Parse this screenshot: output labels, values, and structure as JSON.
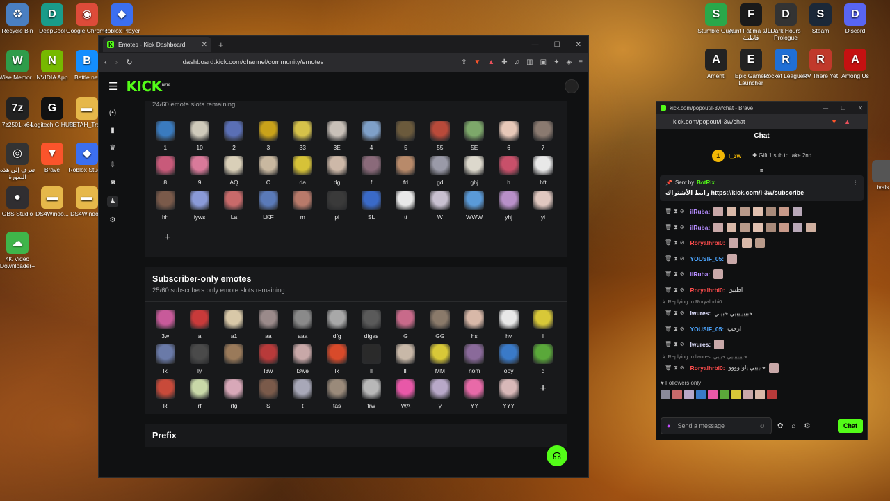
{
  "desktop": {
    "left_icons": [
      {
        "label": "Recycle Bin",
        "icon": "recycle-bin-icon",
        "color": "#4a7fc1",
        "glyph": "♻"
      },
      {
        "label": "DeepCool",
        "icon": "deepcool-icon",
        "color": "#1a9c8a",
        "glyph": "D"
      },
      {
        "label": "Google Chrome",
        "icon": "chrome-icon",
        "color": "#dd4b39",
        "glyph": "◉"
      },
      {
        "label": "Roblox Player",
        "icon": "roblox-icon",
        "color": "#3c6ff0",
        "glyph": "◆"
      },
      {
        "label": "Wise Memor...",
        "icon": "wise-memory-icon",
        "color": "#2f9c4a",
        "glyph": "W"
      },
      {
        "label": "NVIDIA App",
        "icon": "nvidia-icon",
        "color": "#76b900",
        "glyph": "N"
      },
      {
        "label": "Battle.net",
        "icon": "battlenet-icon",
        "color": "#148eff",
        "glyph": "B"
      },
      {
        "label": "7z2501-x64",
        "icon": "7zip-icon",
        "color": "#222222",
        "glyph": "7z"
      },
      {
        "label": "Logitech G HUB",
        "icon": "logitech-icon",
        "color": "#111111",
        "glyph": "G"
      },
      {
        "label": "FETAH_Tra...",
        "icon": "folder-icon",
        "color": "#e6b84a",
        "glyph": "▬"
      },
      {
        "label": "تعرف إلى هذه الصورة",
        "icon": "spotlight-icon",
        "color": "#333333",
        "glyph": "◎"
      },
      {
        "label": "Brave",
        "icon": "brave-icon",
        "color": "#fb542b",
        "glyph": "▼"
      },
      {
        "label": "Roblox Studio",
        "icon": "roblox-studio-icon",
        "color": "#3c6ff0",
        "glyph": "◆"
      },
      {
        "label": "OBS Studio",
        "icon": "obs-icon",
        "color": "#302e31",
        "glyph": "●"
      },
      {
        "label": "DS4Windo...",
        "icon": "folder-icon",
        "color": "#e6b84a",
        "glyph": "▬"
      },
      {
        "label": "DS4Windo...",
        "icon": "folder-icon",
        "color": "#e6b84a",
        "glyph": "▬"
      },
      {
        "label": "4K Video Downloader+",
        "icon": "4k-downloader-icon",
        "color": "#3fb54a",
        "glyph": "☁"
      }
    ],
    "right_icons": [
      {
        "label": "Stumble Guys",
        "icon": "stumble-guys-icon",
        "color": "#2aa84a",
        "glyph": "S"
      },
      {
        "label": "Aunt Fatima حالة فاطمة",
        "icon": "aunt-fatima-icon",
        "color": "#1a1a1a",
        "glyph": "F"
      },
      {
        "label": "Dark Hours Prologue",
        "icon": "dark-hours-icon",
        "color": "#333333",
        "glyph": "D"
      },
      {
        "label": "Steam",
        "icon": "steam-icon",
        "color": "#1b2838",
        "glyph": "S"
      },
      {
        "label": "Discord",
        "icon": "discord-icon",
        "color": "#5865f2",
        "glyph": "D"
      },
      {
        "label": "Amenti",
        "icon": "amenti-icon",
        "color": "#222222",
        "glyph": "A"
      },
      {
        "label": "Epic Games Launcher",
        "icon": "epic-games-icon",
        "color": "#222222",
        "glyph": "E"
      },
      {
        "label": "Rocket League®",
        "icon": "rocket-league-icon",
        "color": "#1f6fd6",
        "glyph": "R"
      },
      {
        "label": "RV There Yet",
        "icon": "rv-there-yet-icon",
        "color": "#c0392b",
        "glyph": "R"
      },
      {
        "label": "Among Us",
        "icon": "among-us-icon",
        "color": "#c51111",
        "glyph": "A"
      },
      {
        "label": "ivals",
        "icon": "partial-icon",
        "color": "#555555",
        "glyph": ""
      }
    ]
  },
  "browser": {
    "tab_title": "Emotes - Kick Dashboard",
    "url": "dashboard.kick.com/channel/community/emotes",
    "logo": "KICK",
    "logo_badge": "BETA",
    "colors": {
      "accent": "#53fc18"
    }
  },
  "emote_sections": {
    "channel": {
      "remaining": "24/60 emote slots remaining",
      "emotes": [
        {
          "label": "1",
          "c": "#3a7bbf"
        },
        {
          "label": "10",
          "c": "#cfcabb"
        },
        {
          "label": "2",
          "c": "#5a6fb5"
        },
        {
          "label": "3",
          "c": "#c9a21a"
        },
        {
          "label": "33",
          "c": "#d6c24a"
        },
        {
          "label": "3E",
          "c": "#c8c0b8"
        },
        {
          "label": "4",
          "c": "#7fa0c8"
        },
        {
          "label": "5",
          "c": "#6b5a3c"
        },
        {
          "label": "55",
          "c": "#b94a3a"
        },
        {
          "label": "5E",
          "c": "#7da86a"
        },
        {
          "label": "6",
          "c": "#e7c8b8"
        },
        {
          "label": "7",
          "c": "#8a7a70"
        },
        {
          "label": "8",
          "c": "#c85a7a"
        },
        {
          "label": "9",
          "c": "#d97a9a"
        },
        {
          "label": "AQ",
          "c": "#d9cfb8"
        },
        {
          "label": "C",
          "c": "#c9b8a0"
        },
        {
          "label": "da",
          "c": "#d6c238"
        },
        {
          "label": "dg",
          "c": "#cdb8a8"
        },
        {
          "label": "f",
          "c": "#8a6a7a"
        },
        {
          "label": "fd",
          "c": "#b88a6a"
        },
        {
          "label": "gd",
          "c": "#9a9aa8"
        },
        {
          "label": "ghj",
          "c": "#dcd8cc"
        },
        {
          "label": "h",
          "c": "#c8506a"
        },
        {
          "label": "hft",
          "c": "#e8e8e8"
        },
        {
          "label": "hh",
          "c": "#7a5a4a"
        },
        {
          "label": "iyws",
          "c": "#8a9ad8"
        },
        {
          "label": "La",
          "c": "#c86a6a"
        },
        {
          "label": "LKF",
          "c": "#5a7ab8"
        },
        {
          "label": "m",
          "c": "#b87a6a"
        },
        {
          "label": "pi",
          "c": "#3a3a3a"
        },
        {
          "label": "SL",
          "c": "#3a6ac8"
        },
        {
          "label": "tt",
          "c": "#e8e8e8"
        },
        {
          "label": "W",
          "c": "#c8c0d0"
        },
        {
          "label": "WWW",
          "c": "#5a9ad8"
        },
        {
          "label": "yhj",
          "c": "#b890c8"
        },
        {
          "label": "yi",
          "c": "#e0c8c0"
        }
      ]
    },
    "subscriber": {
      "title": "Subscriber-only emotes",
      "remaining": "25/60 subscribers only emote slots remaining",
      "emotes": [
        {
          "label": "3w",
          "c": "#c85a9a"
        },
        {
          "label": "a",
          "c": "#c83a3a"
        },
        {
          "label": "a1",
          "c": "#d8c8a8"
        },
        {
          "label": "aa",
          "c": "#9a8a8a"
        },
        {
          "label": "aaa",
          "c": "#8a8a8a"
        },
        {
          "label": "dfg",
          "c": "#a8a8a8"
        },
        {
          "label": "dfgas",
          "c": "#5a5a5a"
        },
        {
          "label": "G",
          "c": "#c86a8a"
        },
        {
          "label": "GG",
          "c": "#8a7a6a"
        },
        {
          "label": "hs",
          "c": "#d8b8a8"
        },
        {
          "label": "hv",
          "c": "#e8e8e8"
        },
        {
          "label": "l",
          "c": "#d8c838"
        },
        {
          "label": "lk",
          "c": "#6a7aa8"
        },
        {
          "label": "ly",
          "c": "#4a4a4a"
        },
        {
          "label": "l",
          "c": "#9a7a5a"
        },
        {
          "label": "l3w",
          "c": "#b83a3a"
        },
        {
          "label": "l3we",
          "c": "#c8a8a8"
        },
        {
          "label": "lk",
          "c": "#d84a2a"
        },
        {
          "label": "ll",
          "c": "#2a2a2a"
        },
        {
          "label": "lll",
          "c": "#c8b8a8"
        },
        {
          "label": "MM",
          "c": "#d8c838"
        },
        {
          "label": "nom",
          "c": "#8a6a9a"
        },
        {
          "label": "opy",
          "c": "#3a7ac8"
        },
        {
          "label": "q",
          "c": "#5aa83a"
        },
        {
          "label": "R",
          "c": "#c84a3a"
        },
        {
          "label": "rf",
          "c": "#c8d8a8"
        },
        {
          "label": "rfg",
          "c": "#d8a8b8"
        },
        {
          "label": "S",
          "c": "#7a5a4a"
        },
        {
          "label": "t",
          "c": "#a8a8b8"
        },
        {
          "label": "tas",
          "c": "#9a8a7a"
        },
        {
          "label": "trw",
          "c": "#b8b8b8"
        },
        {
          "label": "WA",
          "c": "#e858a8"
        },
        {
          "label": "y",
          "c": "#b8a8c8"
        },
        {
          "label": "YY",
          "c": "#e86aa8"
        },
        {
          "label": "YYY",
          "c": "#d8b8b8"
        }
      ]
    },
    "prefix_title": "Prefix"
  },
  "chat": {
    "window_title": "kick.com/popout/l-3w/chat - Brave",
    "url": "kick.com/popout/l-3w/chat",
    "header": "Chat",
    "leader": {
      "rank": "1",
      "name": "l_3w",
      "gift": "Gift 1 sub to take 2nd"
    },
    "pinned": {
      "sent_by": "Sent by",
      "bot": "BotRix",
      "link_text": "https://kick.com/l-3w/subscribe",
      "prefix": "رابط الأشتراك"
    },
    "messages": [
      {
        "user": "ilRuba:",
        "color": "#b58cff",
        "text": "",
        "emotes": 7,
        "reply": ""
      },
      {
        "user": "ilRuba:",
        "color": "#b58cff",
        "text": "",
        "emotes": 8,
        "reply": ""
      },
      {
        "user": "Roryalhrbi0:",
        "color": "#ff4d4d",
        "text": "",
        "emotes": 3,
        "reply": ""
      },
      {
        "user": "YOUSIF_05:",
        "color": "#4da6ff",
        "text": "",
        "emotes": 1,
        "reply": ""
      },
      {
        "user": "ilRuba:",
        "color": "#b58cff",
        "text": "",
        "emotes": 1,
        "reply": ""
      },
      {
        "user": "Roryalhrbi0:",
        "color": "#ff4d4d",
        "text": "اطبين",
        "emotes": 0,
        "reply": ""
      },
      {
        "user": "lwures:",
        "color": "#e0e0ff",
        "text": "حبيييييبيي حبيبي",
        "emotes": 0,
        "reply": "Replying to Roryalhrbi0:"
      },
      {
        "user": "YOUSIF_05:",
        "color": "#4da6ff",
        "text": "ارحب",
        "emotes": 0,
        "reply": ""
      },
      {
        "user": "lwures:",
        "color": "#e0e0ff",
        "text": "",
        "emotes": 1,
        "reply": ""
      },
      {
        "user": "Roryalhrbi0:",
        "color": "#ff4d4d",
        "text": "حبيييي ياولوووو",
        "emotes": 1,
        "reply": "Replying to lwures: حبيييييبيي حبيبي"
      }
    ],
    "followers_only": "Followers only",
    "input_placeholder": "Send a message",
    "send_label": "Chat"
  }
}
